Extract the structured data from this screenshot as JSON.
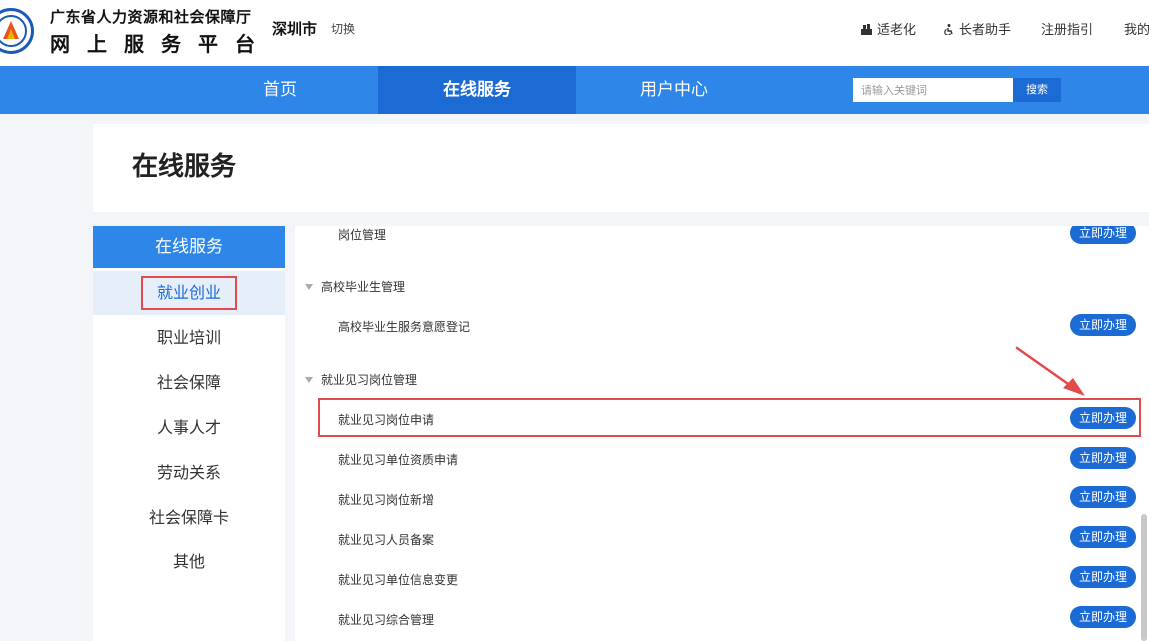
{
  "header": {
    "org_name": "广东省人力资源和社会保障厅",
    "platform_name": "网上服务平台",
    "city": "深圳市",
    "city_switch": "切换",
    "links": [
      "适老化",
      "长者助手",
      "注册指引",
      "我的"
    ]
  },
  "nav": {
    "items": [
      "首页",
      "在线服务",
      "用户中心"
    ],
    "active": "在线服务"
  },
  "search": {
    "placeholder": "请输入关键词",
    "button": "搜索"
  },
  "page_title": "在线服务",
  "sidebar": {
    "header": "在线服务",
    "items": [
      "就业创业",
      "职业培训",
      "社会保障",
      "人事人才",
      "劳动关系",
      "社会保障卡",
      "其他"
    ],
    "active": "就业创业"
  },
  "main": {
    "action_label": "立即办理",
    "rows": [
      {
        "type": "service",
        "name": "岗位管理"
      },
      {
        "type": "group",
        "name": "高校毕业生管理"
      },
      {
        "type": "service",
        "name": "高校毕业生服务意愿登记"
      },
      {
        "type": "group",
        "name": "就业见习岗位管理"
      },
      {
        "type": "service",
        "name": "就业见习岗位申请",
        "highlighted": true
      },
      {
        "type": "service",
        "name": "就业见习单位资质申请"
      },
      {
        "type": "service",
        "name": "就业见习岗位新增"
      },
      {
        "type": "service",
        "name": "就业见习人员备案"
      },
      {
        "type": "service",
        "name": "就业见习单位信息变更"
      },
      {
        "type": "service",
        "name": "就业见习综合管理"
      }
    ]
  },
  "colors": {
    "primary": "#2e87e8",
    "primary_dark": "#1c6ad4",
    "highlight_red": "#e14b4b"
  }
}
